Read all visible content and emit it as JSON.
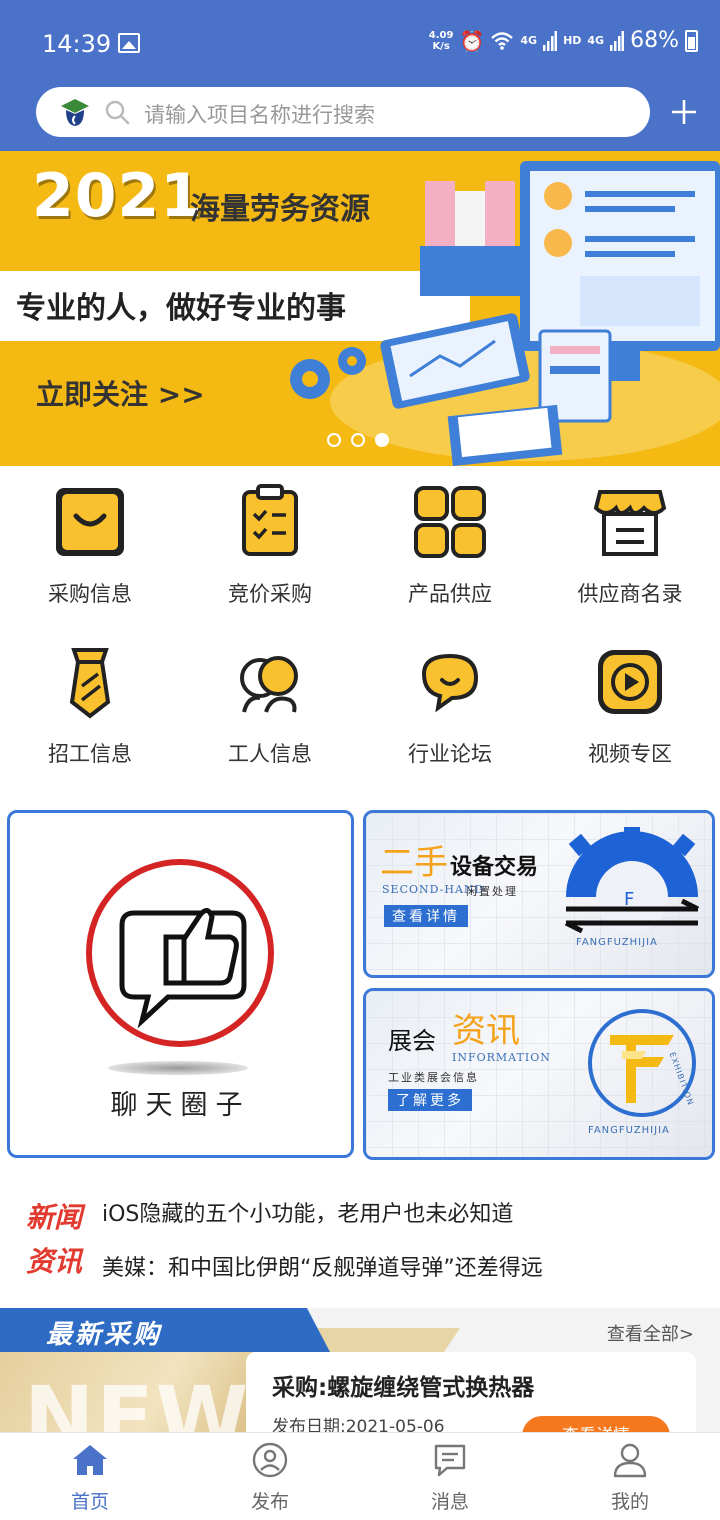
{
  "status_bar": {
    "time": "14:39",
    "net_speed_value": "4.09",
    "net_speed_unit": "K/s",
    "network_label_1": "4G",
    "network_label_2": "HD",
    "network_label_3": "4G",
    "battery": "68%"
  },
  "search": {
    "placeholder": "请输入项目名称进行搜索"
  },
  "banner": {
    "year": "2021",
    "headline": "海量劳务资源",
    "slogan": "专业的人，做好专业的事",
    "cta": "立即关注 >>",
    "active_slide_index": 2,
    "slide_count": 3
  },
  "menu": {
    "items": [
      {
        "label": "采购信息",
        "icon": "shopping-bag-icon"
      },
      {
        "label": "竞价采购",
        "icon": "clipboard-checklist-icon"
      },
      {
        "label": "产品供应",
        "icon": "grid-apps-icon"
      },
      {
        "label": "供应商名录",
        "icon": "store-icon"
      },
      {
        "label": "招工信息",
        "icon": "tie-icon"
      },
      {
        "label": "工人信息",
        "icon": "workers-icon"
      },
      {
        "label": "行业论坛",
        "icon": "chat-bubbles-icon"
      },
      {
        "label": "视频专区",
        "icon": "video-play-icon"
      }
    ]
  },
  "cards": {
    "chat": {
      "title": "聊天圈子"
    },
    "second_hand": {
      "accent": "二手",
      "title": "设备交易",
      "subtitle_en": "SECOND-HAND",
      "subtitle_cn": "闲置处理",
      "button": "查看详情",
      "brand": "FANGFUZHIJIA"
    },
    "expo": {
      "title": "展会",
      "accent": "资讯",
      "subtitle_en": "INFORMATION",
      "subtitle_cn": "工业类展会信息",
      "button": "了解更多",
      "brand": "FANGFUZHIJIA",
      "logo_text": "EXHIBITION"
    }
  },
  "news": {
    "badge_line_1": "新闻",
    "badge_line_2": "资讯",
    "headlines": [
      "iOS隐藏的五个小功能，老用户也未必知道",
      "美媒：和中国比伊朗“反舰弹道导弹”还差得远"
    ]
  },
  "latest": {
    "title": "最新采购",
    "view_all": "查看全部>",
    "bg_text": "NEW",
    "item_title": "采购:螺旋缠绕管式换热器",
    "item_date": "发布日期:2021-05-06",
    "item_button": "查看详情"
  },
  "bottom_nav": {
    "items": [
      {
        "label": "首页",
        "icon": "home-icon",
        "active": true
      },
      {
        "label": "发布",
        "icon": "profile-publish-icon",
        "active": false
      },
      {
        "label": "消息",
        "icon": "message-icon",
        "active": false
      },
      {
        "label": "我的",
        "icon": "user-icon",
        "active": false
      }
    ]
  },
  "colors": {
    "primary": "#4a72c9",
    "banner_yellow": "#f5b914",
    "menu_icon_yellow": "#f9c12e",
    "news_red": "#e23a2e",
    "accent_orange": "#f5781e"
  }
}
